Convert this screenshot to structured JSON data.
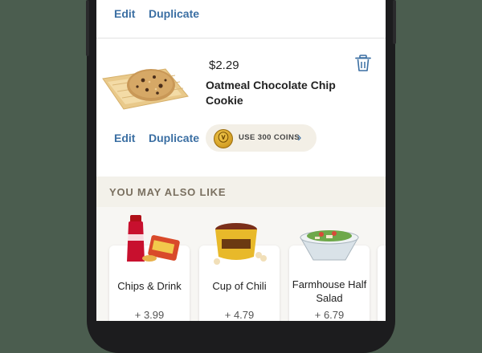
{
  "top_item": {
    "edit_label": "Edit",
    "duplicate_label": "Duplicate"
  },
  "cart_item": {
    "price": "$2.29",
    "name": "Oatmeal Chocolate Chip Cookie",
    "edit_label": "Edit",
    "duplicate_label": "Duplicate",
    "coins_label": "USE 300 COINS",
    "icons": {
      "delete": "trash-icon",
      "coin": "coin-icon",
      "chevron": "chevron-right-icon"
    }
  },
  "recommendations": {
    "title": "YOU MAY ALSO LIKE",
    "items": [
      {
        "name": "Chips & Drink",
        "price": "+ 3.99"
      },
      {
        "name": "Cup of Chili",
        "price": "+ 4.79"
      },
      {
        "name": "Farmhouse Half Salad",
        "price": "+ 6.79"
      }
    ]
  },
  "colors": {
    "background": "#4b5d4f",
    "link": "#3b6fa3",
    "section_band": "#f3f1ea",
    "coins_pill": "#f3efe6"
  }
}
